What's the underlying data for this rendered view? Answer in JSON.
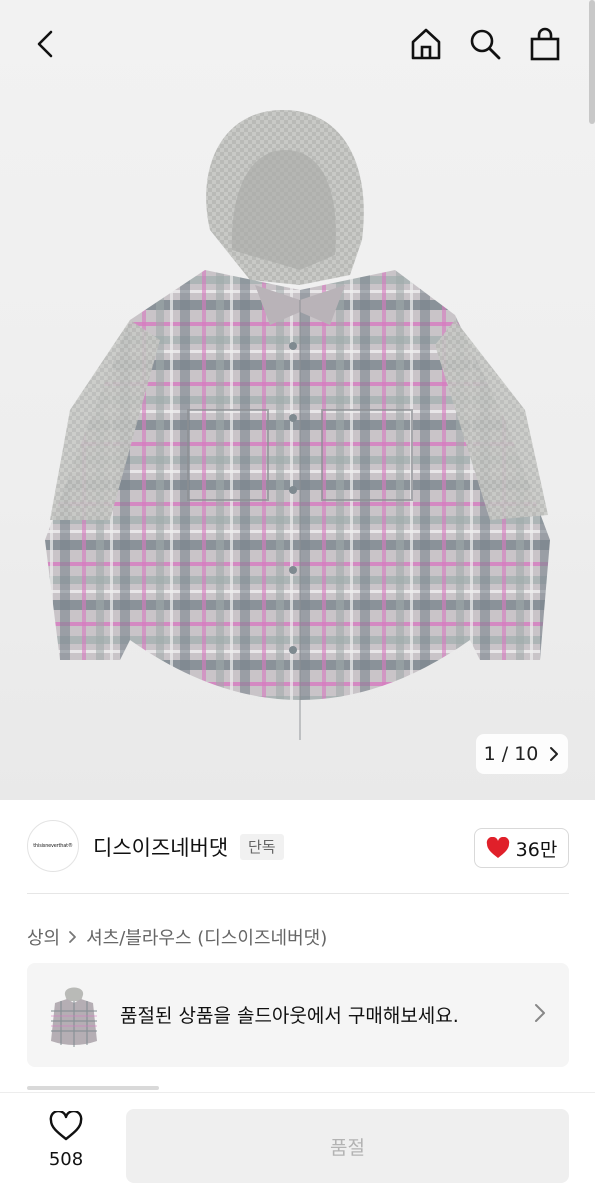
{
  "header": {
    "back_icon": "chevron-left-icon",
    "home_icon": "home-icon",
    "search_icon": "search-icon",
    "bag_icon": "shopping-bag-icon"
  },
  "gallery": {
    "pager": "1 / 10",
    "pager_icon": "chevron-right-icon",
    "background": "#f0f0f0"
  },
  "brand": {
    "logo_text": "thisisneverthat®",
    "name": "디스이즈네버댓",
    "badge": "단독",
    "likes": "36만",
    "heart_color": "#e0202a"
  },
  "breadcrumb": {
    "items": [
      "상의",
      "셔츠/블라우스 (디스이즈네버댓)"
    ]
  },
  "soldout_banner": {
    "text": "품절된 상품을 솔드아웃에서 구매해보세요."
  },
  "bottom_bar": {
    "wish_count": "508",
    "buy_label": "품절"
  }
}
